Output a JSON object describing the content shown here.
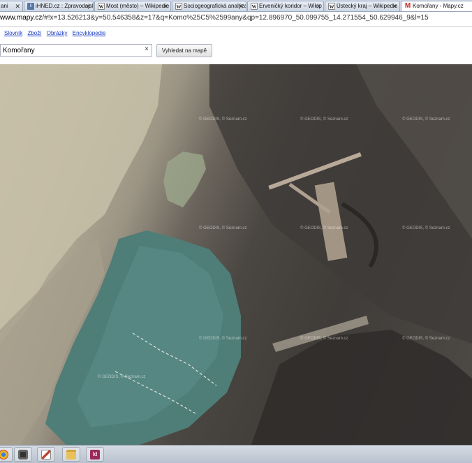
{
  "tabs": [
    {
      "icon": "doc-icon",
      "label": "ani"
    },
    {
      "icon": "doc-icon",
      "label": "iHNED.cz : Zpravodajský s"
    },
    {
      "icon": "wikipedia-icon",
      "label": "Most (město) – Wikipedie"
    },
    {
      "icon": "wikipedia-icon",
      "label": "Sociogeografická analýza"
    },
    {
      "icon": "wikipedia-icon",
      "label": "Erveničký koridor – Wikip"
    },
    {
      "icon": "wikipedia-icon",
      "label": "Ústecký kraj – Wikipedie"
    },
    {
      "icon": "mapy-icon",
      "label": "Komořany - Mapy.cz"
    }
  ],
  "address": {
    "host": "www.mapy.cz",
    "path": "/#!x=13.526213&y=50.546358&z=17&q=Komo%25C5%2599any&qp=12.896970_50.099755_14.271554_50.629946_9&l=15"
  },
  "links": [
    "Slovník",
    "Zboží",
    "Obrázky",
    "Encyklopedie"
  ],
  "search": {
    "value": "Komořany",
    "clear": "×",
    "button": "Vyhledat na mapě"
  },
  "watermark": "© GEODIS, © Seznam.cz",
  "taskbar": [
    {
      "icon": "chrome-icon",
      "color": "#e8b820"
    },
    {
      "icon": "camera-icon",
      "color": "#333333"
    },
    {
      "icon": "pen-icon",
      "color": "#c04030"
    },
    {
      "icon": "folder-icon",
      "color": "#e9c15a"
    },
    {
      "icon": "indesign-icon",
      "color": "#9a2a5a",
      "text": "Id"
    }
  ]
}
